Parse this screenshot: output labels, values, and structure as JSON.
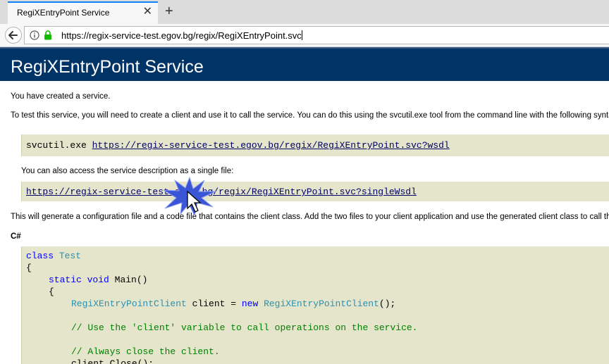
{
  "browser": {
    "tab_title": "RegiXEntryPoint Service",
    "tab_close": "✕",
    "new_tab": "+",
    "url": "https://regix-service-test.egov.bg/regix/RegiXEntryPoint.svc"
  },
  "page": {
    "title": "RegiXEntryPoint Service",
    "intro": "You have created a service.",
    "test_text": "To test this service, you will need to create a client and use it to call the service. You can do this using the svcutil.exe tool from the command line with the following syntax:",
    "svcutil_cmd": "svcutil.exe ",
    "wsdl_link": "https://regix-service-test.egov.bg/regix/RegiXEntryPoint.svc?wsdl",
    "single_file_text": "You can also access the service description as a single file:",
    "single_wsdl_link": "https://regix-service-test.egov.bg/regix/RegiXEntryPoint.svc?singleWsdl",
    "generate_text": "This will generate a configuration file and a code file that contains the client class. Add the two files to your client application and use the generated client class to call the Service.",
    "csharp_heading": "C#",
    "code": {
      "kw_class": "class",
      "type_test": "Test",
      "brace_open": "{",
      "kw_static": "static",
      "kw_void": "void",
      "main": "Main()",
      "inner_brace_open": "{",
      "type_client": "RegiXEntryPointClient",
      "client_var": "client = ",
      "kw_new": "new",
      "ctor_tail": "();",
      "comment1": "// Use the 'client' variable to call operations on the service.",
      "comment2": "// Always close the client.",
      "close_call": "client.Close();"
    }
  }
}
